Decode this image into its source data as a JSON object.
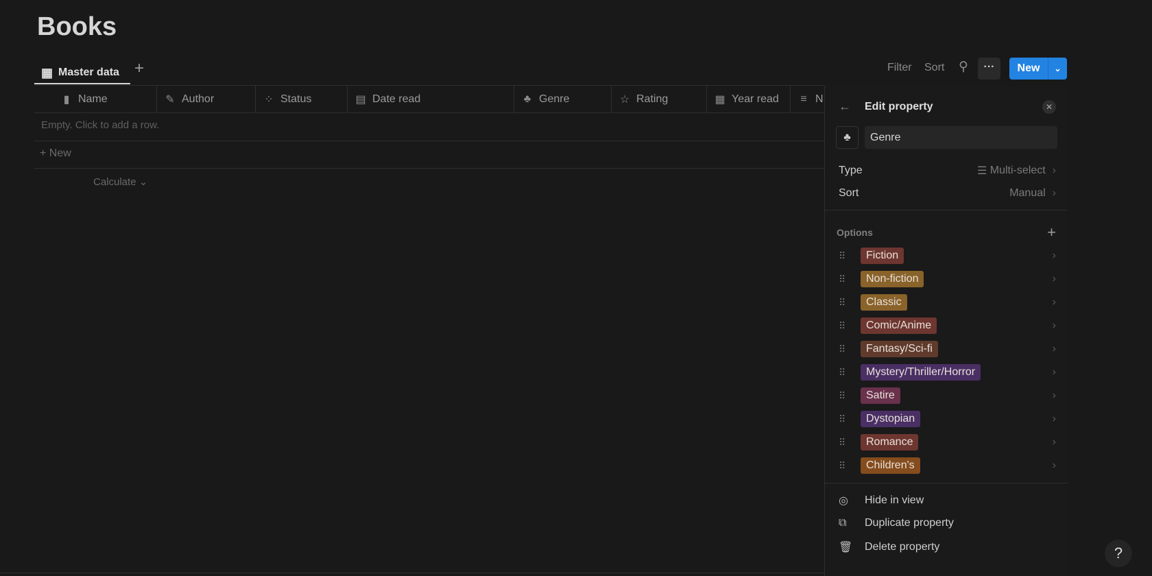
{
  "page": {
    "title": "Books"
  },
  "view": {
    "tab_label": "Master data",
    "toolbar": {
      "filter": "Filter",
      "sort": "Sort",
      "new": "New"
    }
  },
  "table": {
    "columns": [
      {
        "label": "Name",
        "icon": "book-icon"
      },
      {
        "label": "Author",
        "icon": "brush-icon"
      },
      {
        "label": "Status",
        "icon": "status-icon"
      },
      {
        "label": "Date read",
        "icon": "calendar-icon"
      },
      {
        "label": "Genre",
        "icon": "shapes-icon"
      },
      {
        "label": "Rating",
        "icon": "star-icon"
      },
      {
        "label": "Year read",
        "icon": "calendar-grid-icon"
      },
      {
        "label": "N",
        "icon": "text-lines-icon"
      }
    ],
    "empty_text": "Empty. Click to add a row.",
    "new_row": "New",
    "calculate": "Calculate"
  },
  "panel": {
    "title": "Edit property",
    "name_value": "Genre",
    "type_label": "Type",
    "type_value": "Multi-select",
    "sort_label": "Sort",
    "sort_value": "Manual",
    "options_label": "Options",
    "options": [
      {
        "label": "Fiction",
        "color": "#6e3630"
      },
      {
        "label": "Non-fiction",
        "color": "#89632a"
      },
      {
        "label": "Classic",
        "color": "#89632a"
      },
      {
        "label": "Comic/Anime",
        "color": "#6e3630"
      },
      {
        "label": "Fantasy/Sci-fi",
        "color": "#603b2c"
      },
      {
        "label": "Mystery/Thriller/Horror",
        "color": "#492f64"
      },
      {
        "label": "Satire",
        "color": "#69314c"
      },
      {
        "label": "Dystopian",
        "color": "#492f64"
      },
      {
        "label": "Romance",
        "color": "#6e3630"
      },
      {
        "label": "Children's",
        "color": "#854c1d"
      }
    ],
    "actions": [
      {
        "label": "Hide in view",
        "icon": "eye-off-icon"
      },
      {
        "label": "Duplicate property",
        "icon": "duplicate-icon"
      },
      {
        "label": "Delete property",
        "icon": "trash-icon"
      }
    ]
  },
  "help": "?"
}
